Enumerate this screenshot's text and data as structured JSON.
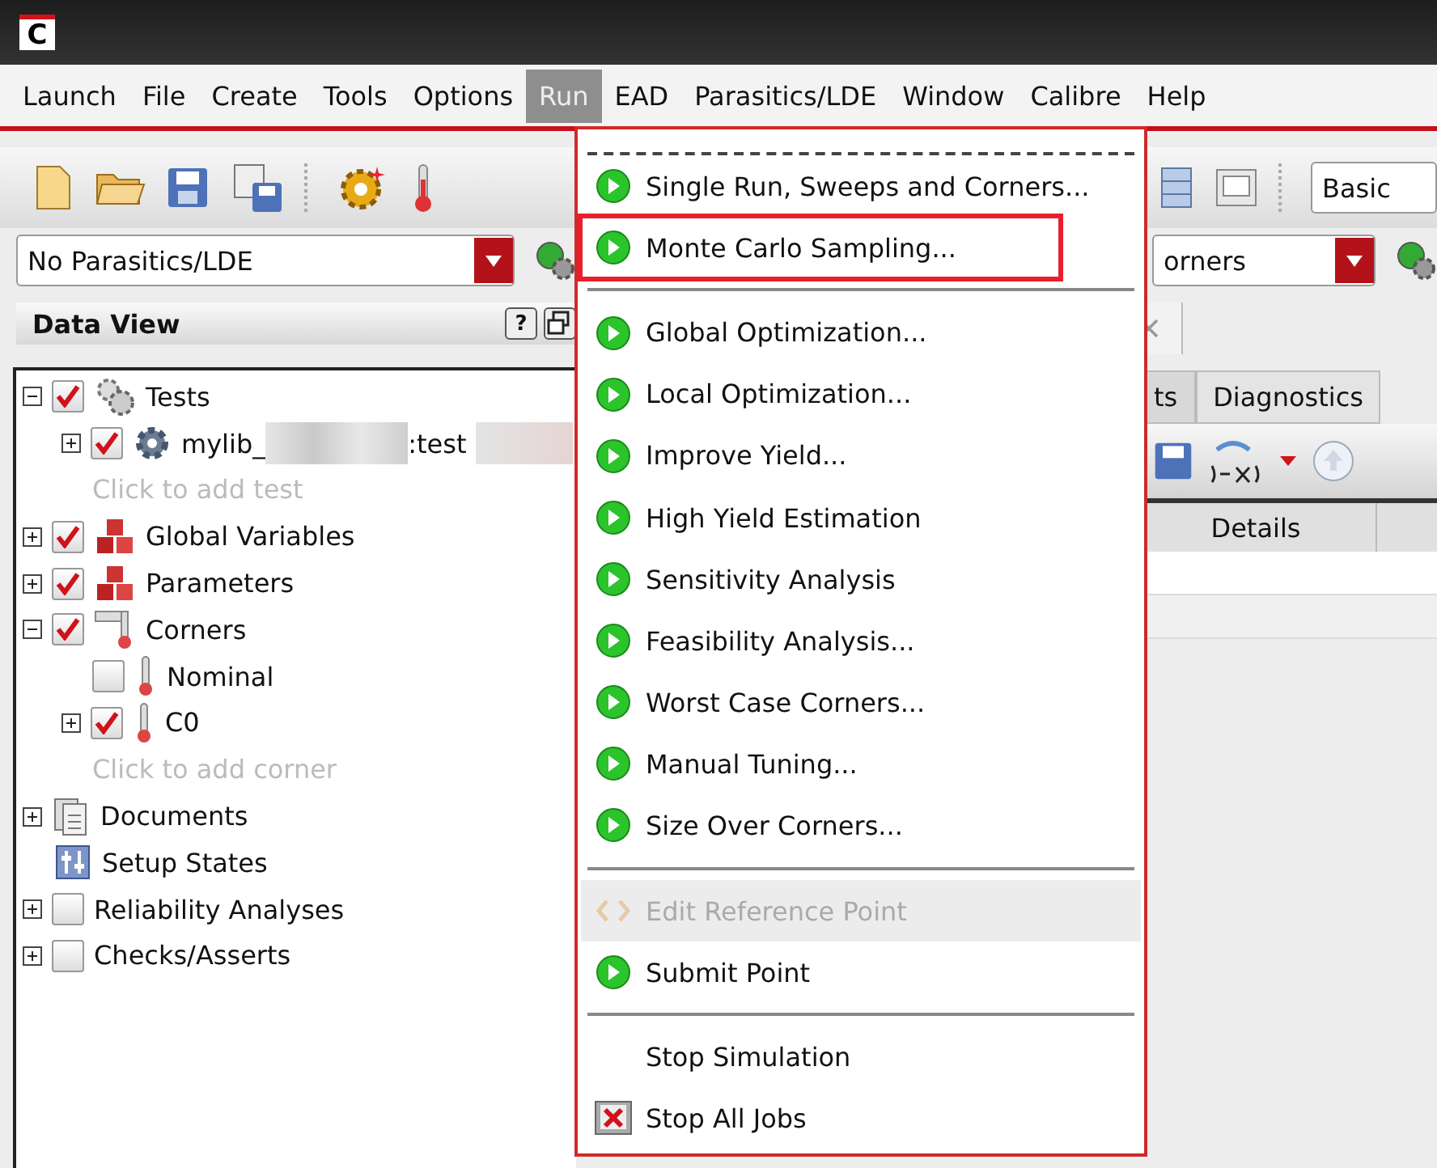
{
  "window": {
    "logo": "C"
  },
  "menubar": [
    {
      "label": "Launch",
      "selected": false
    },
    {
      "label": "File",
      "selected": false
    },
    {
      "label": "Create",
      "selected": false
    },
    {
      "label": "Tools",
      "selected": false
    },
    {
      "label": "Options",
      "selected": false
    },
    {
      "label": "Run",
      "selected": true
    },
    {
      "label": "EAD",
      "selected": false
    },
    {
      "label": "Parasitics/LDE",
      "selected": false
    },
    {
      "label": "Window",
      "selected": false
    },
    {
      "label": "Calibre",
      "selected": false
    },
    {
      "label": "Help",
      "selected": false
    }
  ],
  "toolbar": {
    "mode_combo": "Basic"
  },
  "parasitics_combo": "No Parasitics/LDE",
  "run_mode_combo": "orners",
  "data_view": {
    "title": "Data View",
    "help": "?",
    "tree": [
      {
        "kind": "tests",
        "label": "Tests",
        "checked": true,
        "expanded": true,
        "children": [
          {
            "kind": "test",
            "label": "mylib_",
            "label_suffix": ":test",
            "checked": true,
            "expanded": false
          },
          {
            "kind": "add",
            "label": "Click to add test"
          }
        ]
      },
      {
        "kind": "variables",
        "label": "Global Variables",
        "checked": true,
        "expanded": false
      },
      {
        "kind": "variables",
        "label": "Parameters",
        "checked": true,
        "expanded": false
      },
      {
        "kind": "corners",
        "label": "Corners",
        "checked": true,
        "expanded": true,
        "children": [
          {
            "kind": "corner",
            "label": "Nominal",
            "checked": false
          },
          {
            "kind": "corner",
            "label": "C0",
            "checked": true,
            "expanded": false
          },
          {
            "kind": "add",
            "label": "Click to add corner"
          }
        ]
      },
      {
        "kind": "documents",
        "label": "Documents",
        "expanded": false
      },
      {
        "kind": "states",
        "label": "Setup States"
      },
      {
        "kind": "plain",
        "label": "Reliability Analyses",
        "checked": false,
        "expanded": false
      },
      {
        "kind": "plain",
        "label": "Checks/Asserts",
        "checked": false,
        "expanded": false
      }
    ]
  },
  "right_panel": {
    "tabs": [
      {
        "label": "ts",
        "selected": false
      },
      {
        "label": "Diagnostics",
        "selected": true
      }
    ],
    "columns": [
      "Details"
    ]
  },
  "run_menu": [
    {
      "kind": "tearoff"
    },
    {
      "kind": "run",
      "label": "Single Run, Sweeps and Corners...",
      "disabled": false,
      "highlighted": false
    },
    {
      "kind": "run",
      "label": "Monte Carlo Sampling...",
      "disabled": false,
      "highlighted": true
    },
    {
      "kind": "separator"
    },
    {
      "kind": "run",
      "label": "Global Optimization...",
      "disabled": false,
      "highlighted": false
    },
    {
      "kind": "run",
      "label": "Local Optimization...",
      "disabled": false,
      "highlighted": false
    },
    {
      "kind": "run",
      "label": "Improve Yield...",
      "disabled": false,
      "highlighted": false
    },
    {
      "kind": "run",
      "label": "High Yield Estimation",
      "disabled": false,
      "highlighted": false
    },
    {
      "kind": "run",
      "label": "Sensitivity Analysis",
      "disabled": false,
      "highlighted": false
    },
    {
      "kind": "run",
      "label": "Feasibility Analysis...",
      "disabled": false,
      "highlighted": false
    },
    {
      "kind": "run",
      "label": "Worst Case Corners...",
      "disabled": false,
      "highlighted": false
    },
    {
      "kind": "run",
      "label": "Manual Tuning...",
      "disabled": false,
      "highlighted": false
    },
    {
      "kind": "run",
      "label": "Size Over Corners...",
      "disabled": false,
      "highlighted": false
    },
    {
      "kind": "separator"
    },
    {
      "kind": "reference",
      "label": "Edit Reference Point",
      "disabled": true,
      "highlighted": false
    },
    {
      "kind": "run",
      "label": "Submit Point",
      "disabled": false,
      "highlighted": false
    },
    {
      "kind": "separator"
    },
    {
      "kind": "plain",
      "label": "Stop Simulation",
      "disabled": false,
      "highlighted": false
    },
    {
      "kind": "stop",
      "label": "Stop All Jobs",
      "disabled": false,
      "highlighted": false
    }
  ]
}
